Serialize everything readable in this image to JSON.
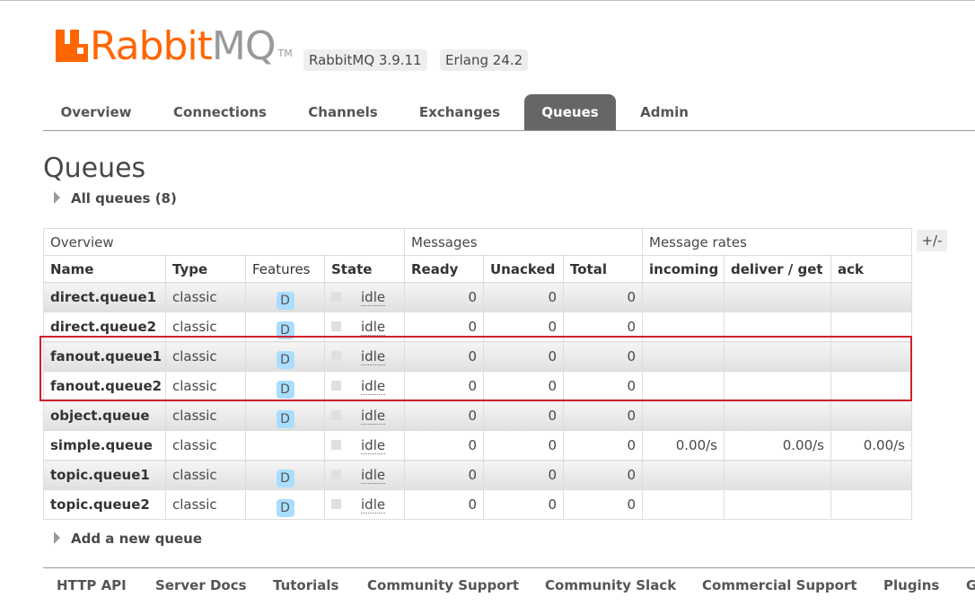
{
  "header": {
    "logo_rabbit": "Rabbit",
    "logo_mq": "MQ",
    "logo_tm": "TM",
    "version": "RabbitMQ 3.9.11",
    "erlang": "Erlang 24.2"
  },
  "tabs": [
    {
      "label": "Overview",
      "active": false
    },
    {
      "label": "Connections",
      "active": false
    },
    {
      "label": "Channels",
      "active": false
    },
    {
      "label": "Exchanges",
      "active": false
    },
    {
      "label": "Queues",
      "active": true
    },
    {
      "label": "Admin",
      "active": false
    }
  ],
  "page": {
    "title": "Queues",
    "all_queues_label": "All queues (8)",
    "add_queue_label": "Add a new queue",
    "columns_toggle": "+/-"
  },
  "table": {
    "groups": {
      "overview": "Overview",
      "messages": "Messages",
      "rates": "Message rates"
    },
    "columns": {
      "name": "Name",
      "type": "Type",
      "features": "Features",
      "state": "State",
      "ready": "Ready",
      "unacked": "Unacked",
      "total": "Total",
      "incoming": "incoming",
      "deliver": "deliver / get",
      "ack": "ack"
    },
    "rows": [
      {
        "name": "direct.queue1",
        "type": "classic",
        "feature": "D",
        "state": "idle",
        "ready": "0",
        "unacked": "0",
        "total": "0",
        "incoming": "",
        "deliver": "",
        "ack": ""
      },
      {
        "name": "direct.queue2",
        "type": "classic",
        "feature": "D",
        "state": "idle",
        "ready": "0",
        "unacked": "0",
        "total": "0",
        "incoming": "",
        "deliver": "",
        "ack": ""
      },
      {
        "name": "fanout.queue1",
        "type": "classic",
        "feature": "D",
        "state": "idle",
        "ready": "0",
        "unacked": "0",
        "total": "0",
        "incoming": "",
        "deliver": "",
        "ack": ""
      },
      {
        "name": "fanout.queue2",
        "type": "classic",
        "feature": "D",
        "state": "idle",
        "ready": "0",
        "unacked": "0",
        "total": "0",
        "incoming": "",
        "deliver": "",
        "ack": ""
      },
      {
        "name": "object.queue",
        "type": "classic",
        "feature": "D",
        "state": "idle",
        "ready": "0",
        "unacked": "0",
        "total": "0",
        "incoming": "",
        "deliver": "",
        "ack": ""
      },
      {
        "name": "simple.queue",
        "type": "classic",
        "feature": "",
        "state": "idle",
        "ready": "0",
        "unacked": "0",
        "total": "0",
        "incoming": "0.00/s",
        "deliver": "0.00/s",
        "ack": "0.00/s"
      },
      {
        "name": "topic.queue1",
        "type": "classic",
        "feature": "D",
        "state": "idle",
        "ready": "0",
        "unacked": "0",
        "total": "0",
        "incoming": "",
        "deliver": "",
        "ack": ""
      },
      {
        "name": "topic.queue2",
        "type": "classic",
        "feature": "D",
        "state": "idle",
        "ready": "0",
        "unacked": "0",
        "total": "0",
        "incoming": "",
        "deliver": "",
        "ack": ""
      }
    ]
  },
  "footer": [
    "HTTP API",
    "Server Docs",
    "Tutorials",
    "Community Support",
    "Community Slack",
    "Commercial Support",
    "Plugins",
    "GitHub"
  ],
  "colors": {
    "brand": "#ff6600",
    "highlight": "#d0202a",
    "active_tab": "#666666"
  }
}
